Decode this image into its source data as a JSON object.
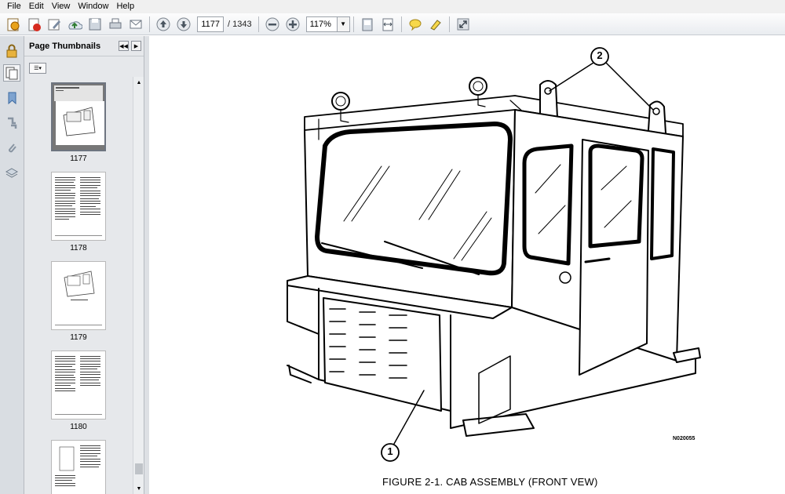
{
  "menu": [
    "File",
    "Edit",
    "View",
    "Window",
    "Help"
  ],
  "toolbar": {
    "page_current": "1177",
    "page_total": "/ 1343",
    "zoom": "117%",
    "icons": [
      "create-pdf-icon",
      "open-icon",
      "edit-icon",
      "upload-icon",
      "save-icon",
      "print-icon",
      "email-icon",
      "prev-page-icon",
      "next-page-icon",
      "zoom-out-icon",
      "zoom-in-icon",
      "fit-page-icon",
      "fit-width-icon",
      "comment-icon",
      "highlight-icon",
      "fullscreen-icon"
    ]
  },
  "rail_icons": [
    "lock-icon",
    "pages-icon",
    "bookmark-icon",
    "attachments-link-icon",
    "paperclip-icon",
    "layers-icon"
  ],
  "thumbnails": {
    "title": "Page Thumbnails",
    "pages": [
      {
        "label": "1177",
        "selected": true
      },
      {
        "label": "1178",
        "selected": false
      },
      {
        "label": "1179",
        "selected": false
      },
      {
        "label": "1180",
        "selected": false
      },
      {
        "label": "",
        "selected": false
      }
    ]
  },
  "document": {
    "callout_1": "1",
    "callout_2": "2",
    "figure_code": "N020055",
    "caption": "FIGURE 2-1. CAB ASSEMBLY (FRONT VEW)"
  }
}
